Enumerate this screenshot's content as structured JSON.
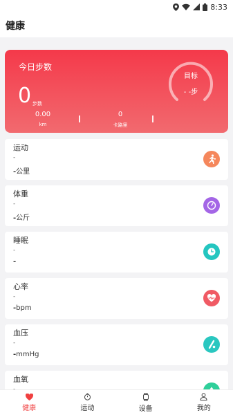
{
  "status_bar": {
    "time": "8:33"
  },
  "header": {
    "title": "健康"
  },
  "steps_card": {
    "title": "今日步数",
    "steps_value": "0",
    "steps_unit": "步数",
    "distance_value": "0.00",
    "distance_unit": "km",
    "calories_value": "0",
    "calories_unit": "卡路里",
    "goal_label": "目标",
    "goal_value": "- -步"
  },
  "metrics": [
    {
      "title": "运动",
      "dash": "-",
      "value": "-",
      "unit": "公里",
      "icon": "running-icon",
      "color": "#f5875c"
    },
    {
      "title": "体重",
      "dash": "-",
      "value": "-",
      "unit": "公斤",
      "icon": "scale-icon",
      "color": "#a466e6"
    },
    {
      "title": "睡眠",
      "dash": "-",
      "value": "-",
      "unit": "",
      "icon": "moon-clock-icon",
      "color": "#24c6c0"
    },
    {
      "title": "心率",
      "dash": "-",
      "value": "-",
      "unit": "bpm",
      "icon": "heart-rate-icon",
      "color": "#f05a64"
    },
    {
      "title": "血压",
      "dash": "-",
      "value": "-",
      "unit": "mmHg",
      "icon": "blood-pressure-icon",
      "color": "#2ac7c0"
    },
    {
      "title": "血氧",
      "dash": "-",
      "value": "",
      "unit": "",
      "icon": "blood-oxygen-icon",
      "color": "#2fcf9a"
    }
  ],
  "bottom_nav": [
    {
      "label": "健康",
      "icon": "heart-icon",
      "active": true
    },
    {
      "label": "运动",
      "icon": "stopwatch-icon",
      "active": false
    },
    {
      "label": "设备",
      "icon": "watch-icon",
      "active": false
    },
    {
      "label": "我的",
      "icon": "person-icon",
      "active": false
    }
  ]
}
